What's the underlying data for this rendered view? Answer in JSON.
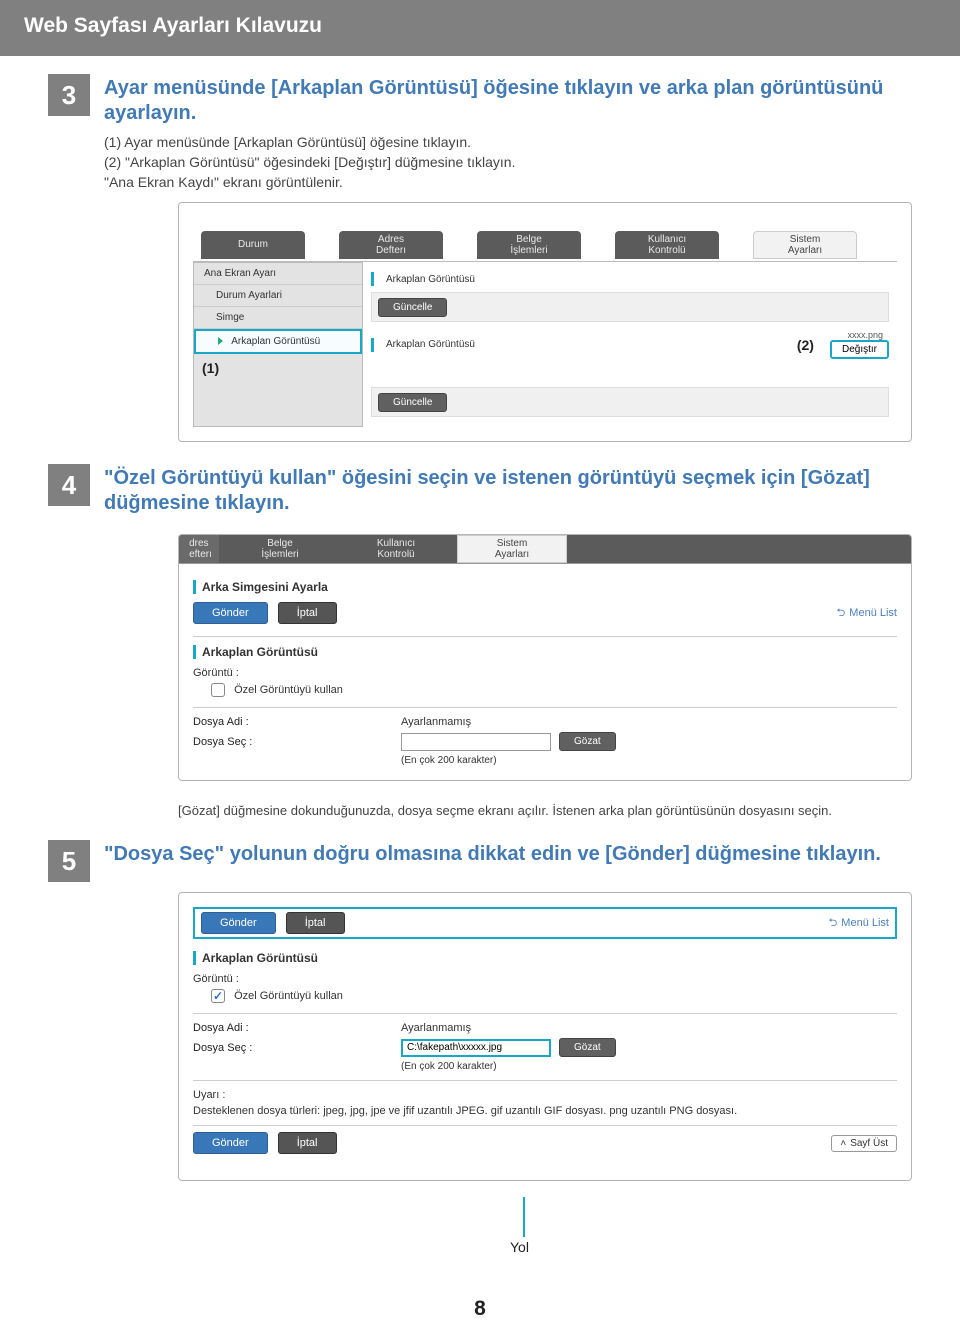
{
  "header": {
    "title": "Web Sayfası Ayarları Kılavuzu"
  },
  "step3": {
    "num": "3",
    "title": "Ayar menüsünde [Arkaplan Görüntüsü] öğesine tıklayın ve arka plan görüntüsünü ayarlayın.",
    "lines": [
      "(1) Ayar menüsünde [Arkaplan Görüntüsü] öğesine tıklayın.",
      "(2) \"Arkaplan Görüntüsü\" öğesindeki [Değıştır] düğmesine tıklayın.",
      "\"Ana Ekran Kaydı\" ekranı görüntülenir."
    ],
    "screenshot": {
      "tabs": [
        "Durum",
        "Adres\nDefterı",
        "Belge\nİşlemleri",
        "Kullanıcı\nKontrolü",
        "Sistem\nAyarları"
      ],
      "sidenav": [
        "Ana Ekran Ayarı",
        "Durum Ayarlari",
        "Simge",
        "Arkaplan Görüntüsü"
      ],
      "marker1": "(1)",
      "panel_heading1": "Arkaplan Görüntüsü",
      "btn_update": "Güncelle",
      "panel_heading2": "Arkaplan Görüntüsü",
      "png_label": "xxxx.png",
      "marker2": "(2)",
      "btn_change": "Değıştır",
      "btn_update2": "Güncelle"
    }
  },
  "step4": {
    "num": "4",
    "title": "\"Özel Görüntüyü kullan\" öğesini seçin ve istenen görüntüyü seçmek için [Gözat] düğmesine tıklayın.",
    "screenshot": {
      "tabs_partial": "dres\nefterı",
      "tabs": [
        "Belge\nİşlemleri",
        "Kullanıcı\nKontrolü",
        "Sistem\nAyarları"
      ],
      "section_head": "Arka Simgesini Ayarla",
      "btn_send": "Gönder",
      "btn_cancel": "İptal",
      "menu_link": "Menü List",
      "section_head2": "Arkaplan Görüntüsü",
      "img_label": "Görüntü :",
      "use_custom": "Özel Görüntüyü kullan",
      "file_name_label": "Dosya Adi :",
      "file_name_value": "Ayarlanmamış",
      "file_select_label": "Dosya Seç :",
      "file_select_value": "",
      "btn_browse": "Gözat",
      "note_max": "(En çok 200 karakter)"
    },
    "caption": "[Gözat] düğmesine dokunduğunuzda, dosya seçme ekranı açılır. İstenen arka plan görüntüsünün dosyasını seçin."
  },
  "step5": {
    "num": "5",
    "title": "\"Dosya Seç\" yolunun doğru olmasına dikkat edin ve [Gönder] düğmesine tıklayın.",
    "screenshot": {
      "btn_send": "Gönder",
      "btn_cancel": "İptal",
      "menu_link": "Menü List",
      "section_head2": "Arkaplan Görüntüsü",
      "img_label": "Görüntü :",
      "use_custom": "Özel Görüntüyü kullan",
      "file_name_label": "Dosya Adi :",
      "file_name_value": "Ayarlanmamış",
      "file_select_label": "Dosya Seç :",
      "file_select_value": "C:\\fakepath\\xxxxx.jpg",
      "btn_browse": "Gözat",
      "note_max": "(En çok 200 karakter)",
      "warn_label": "Uyarı :",
      "warn_text": "Desteklenen dosya türleri: jpeg, jpg, jpe ve jfif uzantılı JPEG. gif uzantılı GIF dosyası. png uzantılı PNG dosyası.",
      "btn_top": "Sayf Üst",
      "yol_label": "Yol"
    }
  },
  "page_number": "8"
}
